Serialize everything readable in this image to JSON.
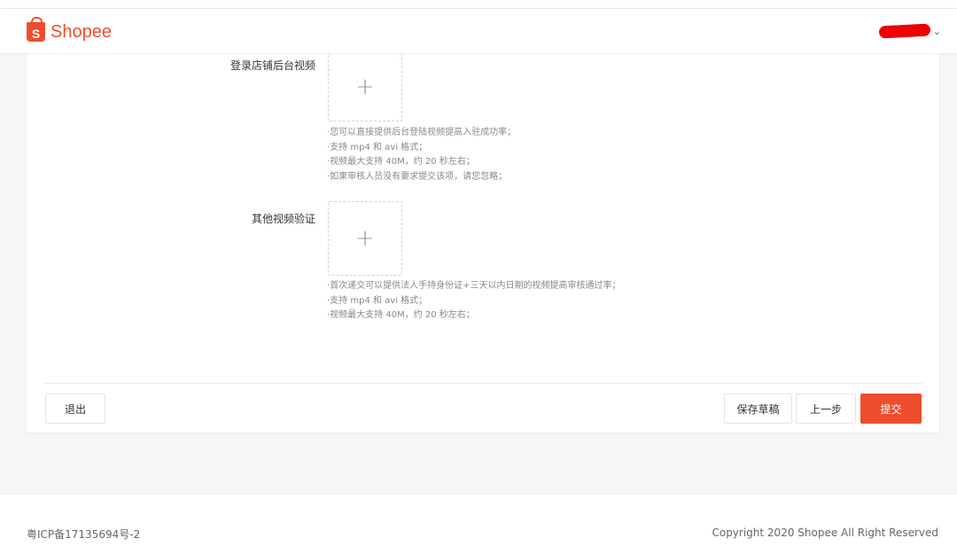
{
  "brand": {
    "logo_glyph": "S",
    "name": "Shopee",
    "accent_color": "#ee4d2d"
  },
  "user_menu": {
    "chevron_icon": "chevron-down-icon"
  },
  "form": {
    "fields": [
      {
        "label": "登录店铺后台视频",
        "upload_icon": "plus-icon",
        "hints": [
          "·您可以直接提供后台登陆视频提高入驻成功率；",
          "·支持 mp4 和 avi 格式；",
          "·视频最大支持 40M，约 20 秒左右；",
          "·如果审核人员没有要求提交该项，请您忽略；"
        ]
      },
      {
        "label": "其他视频验证",
        "upload_icon": "plus-icon",
        "hints": [
          "·首次递交可以提供法人手持身份证+三天以内日期的视频提高审核通过率；",
          "·支持 mp4 和 avi 格式；",
          "·视频最大支持 40M，约 20 秒左右；"
        ]
      }
    ],
    "buttons": {
      "exit": "退出",
      "save_draft": "保存草稿",
      "previous": "上一步",
      "submit": "提交"
    }
  },
  "footer": {
    "icp": "粤ICP备17135694号-2",
    "copyright": "Copyright 2020 Shopee All Right Reserved"
  }
}
